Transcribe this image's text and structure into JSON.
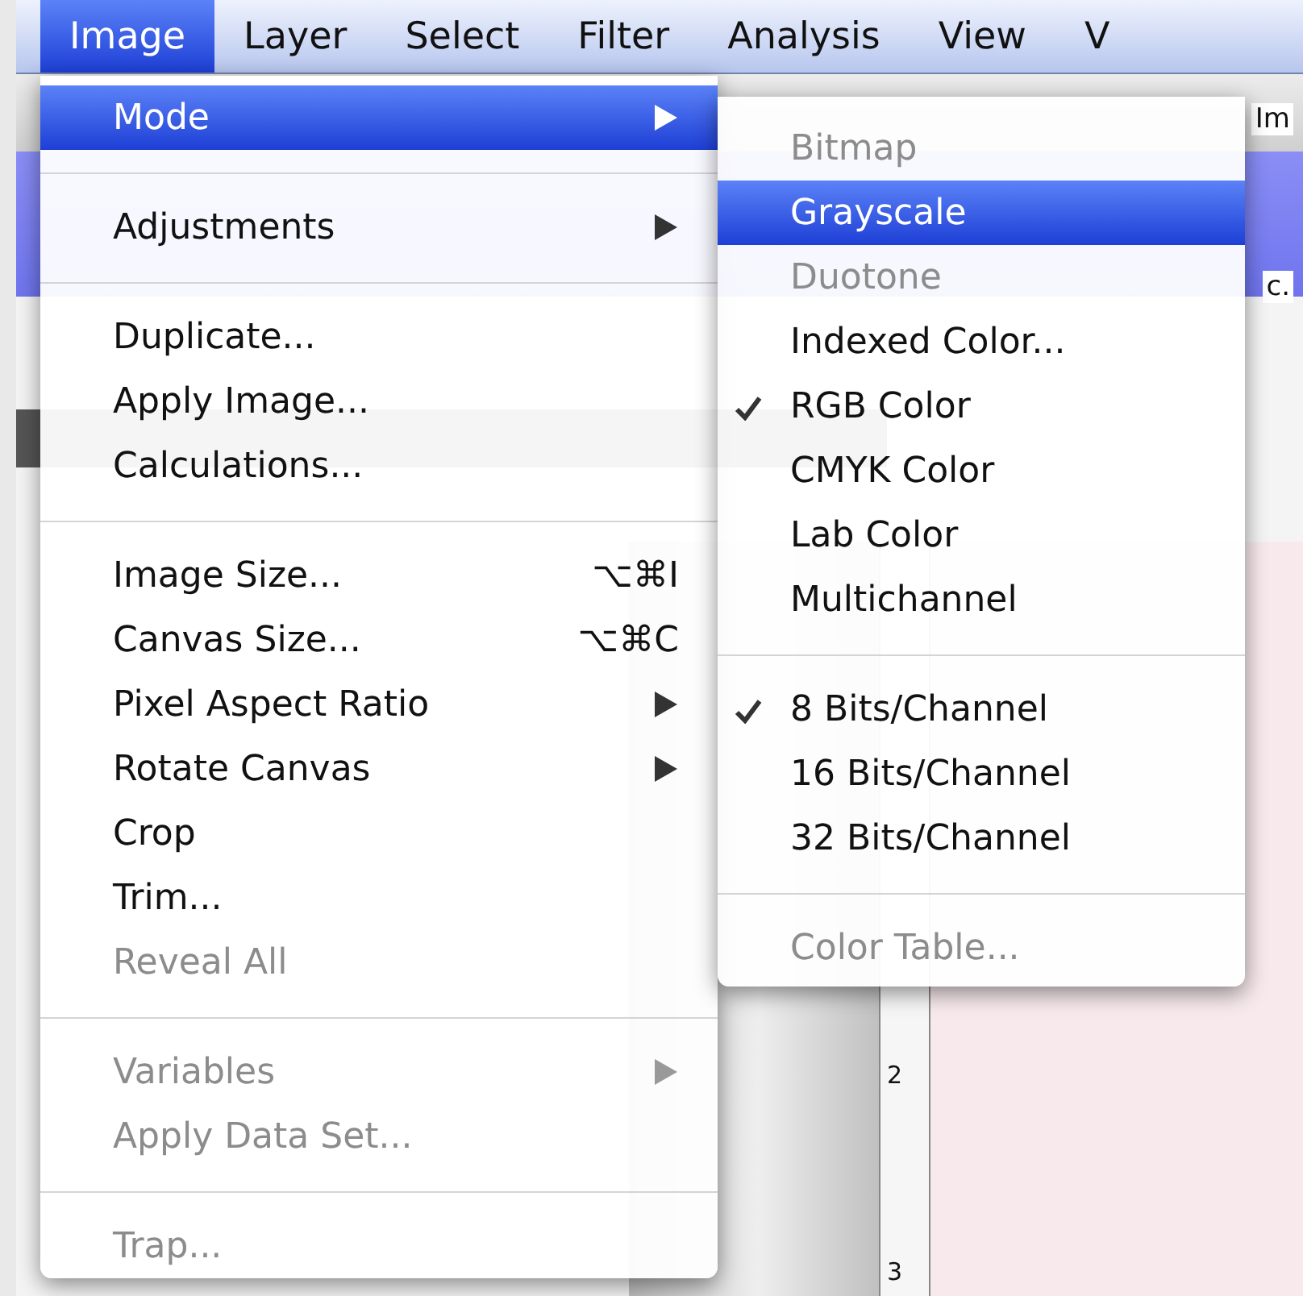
{
  "menubar": {
    "items": [
      {
        "label": "Image",
        "selected": true
      },
      {
        "label": "Layer",
        "selected": false
      },
      {
        "label": "Select",
        "selected": false
      },
      {
        "label": "Filter",
        "selected": false
      },
      {
        "label": "Analysis",
        "selected": false
      },
      {
        "label": "View",
        "selected": false
      },
      {
        "label": "V",
        "selected": false
      }
    ]
  },
  "background": {
    "labels": [
      "Im",
      "c."
    ],
    "ruler_labels": [
      "2",
      "3"
    ]
  },
  "image_menu": {
    "items": [
      {
        "kind": "item",
        "label": "Mode",
        "has_submenu": true,
        "disabled": false,
        "selected": true
      },
      {
        "kind": "separator"
      },
      {
        "kind": "item",
        "label": "Adjustments",
        "has_submenu": true,
        "disabled": false,
        "selected": false
      },
      {
        "kind": "separator"
      },
      {
        "kind": "item",
        "label": "Duplicate...",
        "disabled": false,
        "selected": false
      },
      {
        "kind": "item",
        "label": "Apply Image...",
        "disabled": false,
        "selected": false
      },
      {
        "kind": "item",
        "label": "Calculations...",
        "disabled": false,
        "selected": false
      },
      {
        "kind": "separator"
      },
      {
        "kind": "item",
        "label": "Image Size...",
        "shortcut": "⌥⌘I",
        "disabled": false,
        "selected": false
      },
      {
        "kind": "item",
        "label": "Canvas Size...",
        "shortcut": "⌥⌘C",
        "disabled": false,
        "selected": false
      },
      {
        "kind": "item",
        "label": "Pixel Aspect Ratio",
        "has_submenu": true,
        "disabled": false,
        "selected": false
      },
      {
        "kind": "item",
        "label": "Rotate Canvas",
        "has_submenu": true,
        "disabled": false,
        "selected": false
      },
      {
        "kind": "item",
        "label": "Crop",
        "disabled": false,
        "selected": false
      },
      {
        "kind": "item",
        "label": "Trim...",
        "disabled": false,
        "selected": false
      },
      {
        "kind": "item",
        "label": "Reveal All",
        "disabled": true,
        "selected": false
      },
      {
        "kind": "separator"
      },
      {
        "kind": "item",
        "label": "Variables",
        "has_submenu": true,
        "disabled": true,
        "selected": false
      },
      {
        "kind": "item",
        "label": "Apply Data Set...",
        "disabled": true,
        "selected": false
      },
      {
        "kind": "separator"
      },
      {
        "kind": "item",
        "label": "Trap...",
        "disabled": true,
        "selected": false
      }
    ]
  },
  "mode_submenu": {
    "items": [
      {
        "kind": "item",
        "label": "Bitmap",
        "checked": false,
        "disabled": true,
        "selected": false
      },
      {
        "kind": "item",
        "label": "Grayscale",
        "checked": false,
        "disabled": false,
        "selected": true
      },
      {
        "kind": "item",
        "label": "Duotone",
        "checked": false,
        "disabled": true,
        "selected": false
      },
      {
        "kind": "item",
        "label": "Indexed Color...",
        "checked": false,
        "disabled": false,
        "selected": false
      },
      {
        "kind": "item",
        "label": "RGB Color",
        "checked": true,
        "disabled": false,
        "selected": false
      },
      {
        "kind": "item",
        "label": "CMYK Color",
        "checked": false,
        "disabled": false,
        "selected": false
      },
      {
        "kind": "item",
        "label": "Lab Color",
        "checked": false,
        "disabled": false,
        "selected": false
      },
      {
        "kind": "item",
        "label": "Multichannel",
        "checked": false,
        "disabled": false,
        "selected": false
      },
      {
        "kind": "separator"
      },
      {
        "kind": "item",
        "label": "8 Bits/Channel",
        "checked": true,
        "disabled": false,
        "selected": false
      },
      {
        "kind": "item",
        "label": "16 Bits/Channel",
        "checked": false,
        "disabled": false,
        "selected": false
      },
      {
        "kind": "item",
        "label": "32 Bits/Channel",
        "checked": false,
        "disabled": false,
        "selected": false
      },
      {
        "kind": "separator"
      },
      {
        "kind": "item",
        "label": "Color Table...",
        "checked": false,
        "disabled": true,
        "selected": false
      }
    ]
  }
}
